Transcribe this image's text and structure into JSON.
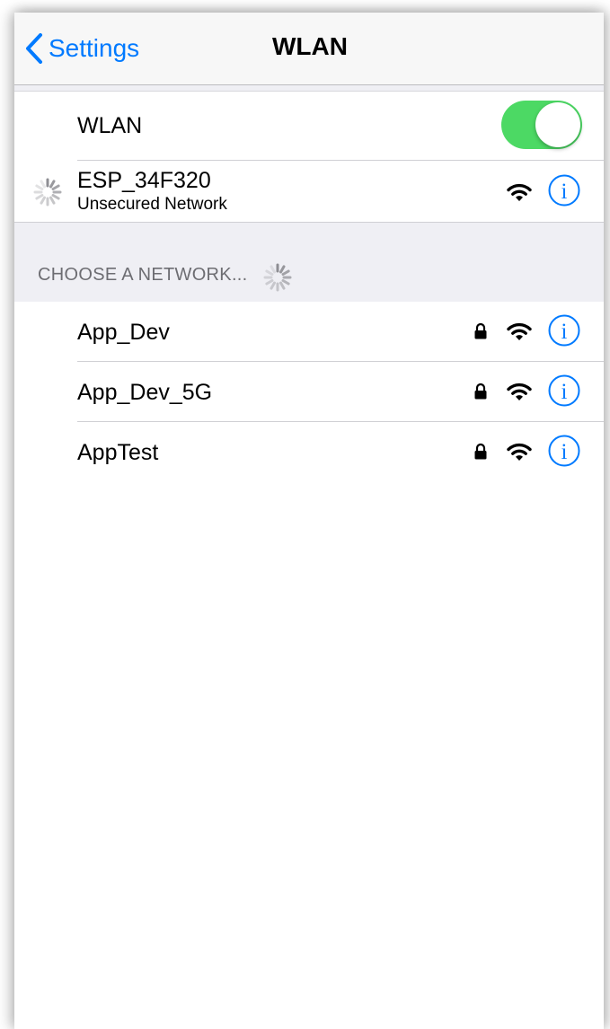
{
  "navbar": {
    "back_label": "Settings",
    "title": "WLAN"
  },
  "wlan_toggle": {
    "label": "WLAN",
    "on": true,
    "accent_color": "#4cd964"
  },
  "current_network": {
    "name": "ESP_34F320",
    "status": "Unsecured Network"
  },
  "section_header": "CHOOSE A NETWORK...",
  "networks": [
    {
      "name": "App_Dev",
      "secured": true
    },
    {
      "name": "App_Dev_5G",
      "secured": true
    },
    {
      "name": "AppTest",
      "secured": true
    }
  ],
  "colors": {
    "accent": "#007aff",
    "toggle_on": "#4cd964",
    "group_background": "#efeff4"
  },
  "icons": {
    "back": "chevron-left-icon",
    "spinner": "spinner-icon",
    "wifi": "wifi-icon",
    "lock": "lock-icon",
    "info": "info-icon"
  }
}
